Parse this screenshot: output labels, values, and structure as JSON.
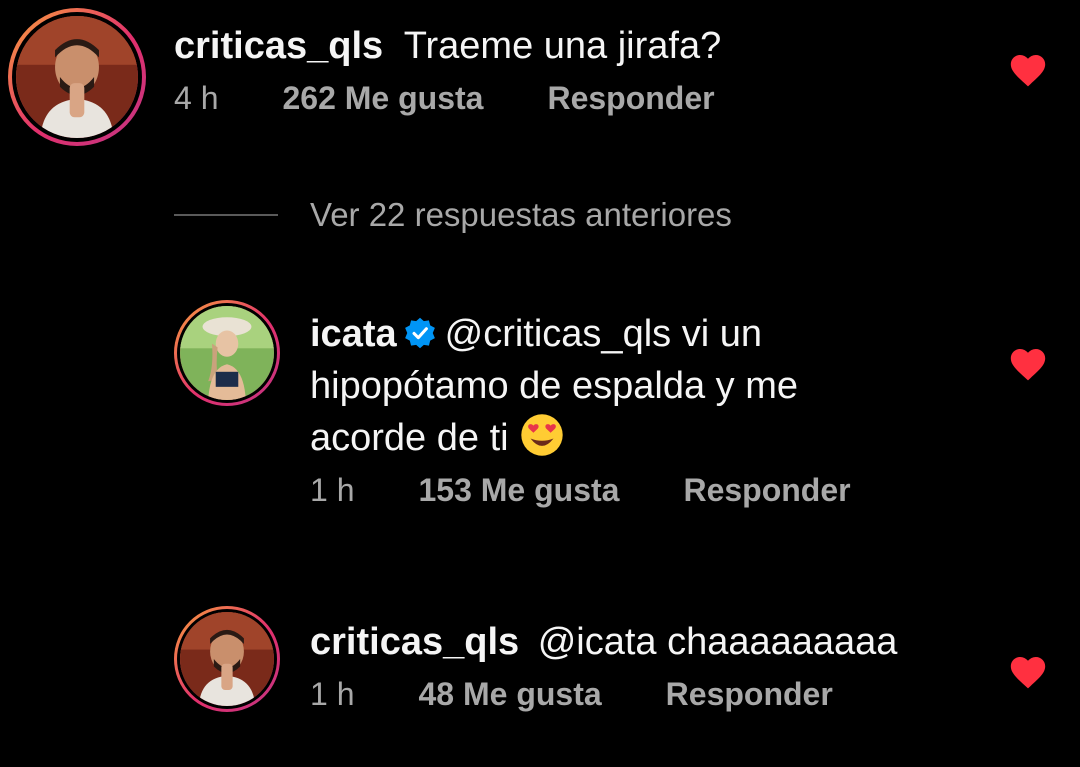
{
  "comment1": {
    "username": "criticas_qls",
    "text": "Traeme una jirafa?",
    "time": "4 h",
    "likes": "262 Me gusta",
    "reply": "Responder"
  },
  "view_more": {
    "label": "Ver 22 respuestas anteriores"
  },
  "reply1": {
    "username": "icata",
    "line1": "@criticas_qls vi un",
    "line2": "hipopótamo de espalda y me",
    "line3": "acorde de ti",
    "emoji": "heart-eyes-emoji",
    "time": "1 h",
    "likes": "153 Me gusta",
    "reply": "Responder"
  },
  "reply2": {
    "username": "criticas_qls",
    "text": "@icata chaaaaaaaaa",
    "time": "1 h",
    "likes": "48 Me gusta",
    "reply": "Responder"
  },
  "icons": {
    "like": "heart-icon",
    "verified": "verified-badge-icon"
  },
  "colors": {
    "background": "#000000",
    "primary_text": "#f5f5f5",
    "secondary_text": "#a8a8a8",
    "like_heart": "#ff3040",
    "verified": "#0095f6"
  }
}
